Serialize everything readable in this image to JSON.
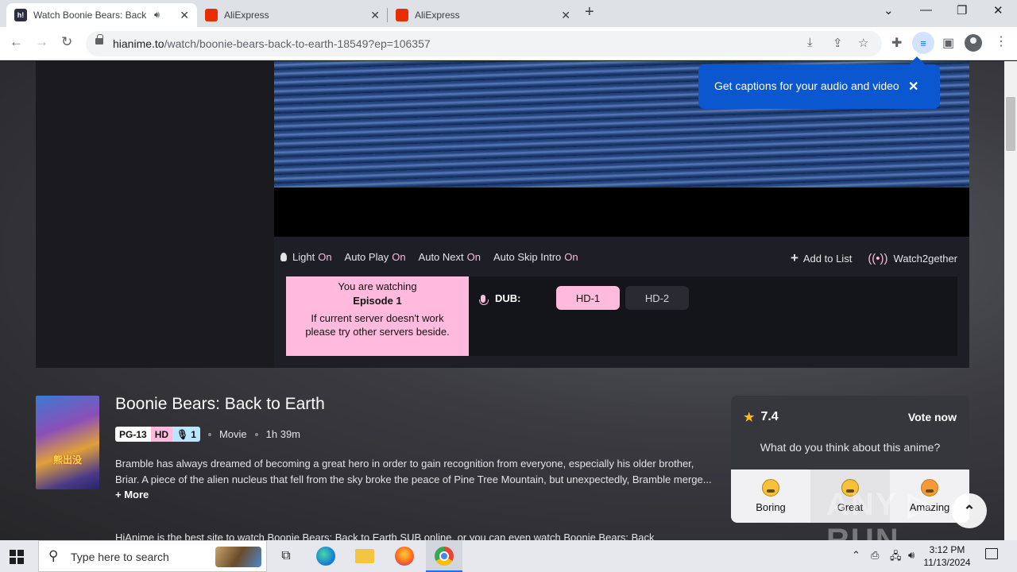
{
  "browser": {
    "tabs": [
      {
        "title": "Watch Boonie Bears: Back to",
        "favicon_label": "h!",
        "favicon_color": "#2b2d42",
        "active": true,
        "audio": true
      },
      {
        "title": "AliExpress",
        "favicon_label": "",
        "favicon_color": "#e62e04",
        "active": false
      },
      {
        "title": "AliExpress",
        "favicon_label": "",
        "favicon_color": "#e62e04",
        "active": false
      }
    ],
    "url_domain": "hianime.to",
    "url_path": "/watch/boonie-bears-back-to-earth-18549?ep=106357",
    "captions_popup": "Get captions for your audio and video"
  },
  "player": {
    "controls": [
      {
        "label": "Light",
        "state": "On"
      },
      {
        "label": "Auto Play",
        "state": "On"
      },
      {
        "label": "Auto Next",
        "state": "On"
      },
      {
        "label": "Auto Skip Intro",
        "state": "On"
      }
    ],
    "add_to_list": "Add to List",
    "watch2gether": "Watch2gether",
    "watching_line1": "You are watching",
    "watching_episode": "Episode 1",
    "watching_hint": "If current server doesn't work please try other servers beside.",
    "dub_label": "DUB:",
    "servers": [
      "HD-1",
      "HD-2"
    ],
    "accent_color": "#ffbade"
  },
  "anime": {
    "title": "Boonie Bears: Back to Earth",
    "badge_rating": "PG-13",
    "badge_quality": "HD",
    "badge_dub": "1",
    "type": "Movie",
    "duration": "1h 39m",
    "description": "Bramble has always dreamed of becoming a great hero in order to gain recognition from everyone, especially his older brother, Briar. A piece of the alien nucleus that fell from the sky broke the peace of Pine Tree Mountain, but unexpectedly, Bramble merge...",
    "more": "+ More",
    "description2": "HiAnime is the best site to watch Boonie Bears: Back to Earth SUB online, or you can even watch Boonie Bears: Back"
  },
  "vote": {
    "score": "7.4",
    "vote_now": "Vote now",
    "question": "What do you think about this anime?",
    "options": [
      "Boring",
      "Great",
      "Amazing"
    ]
  },
  "taskbar": {
    "search_placeholder": "Type here to search",
    "time": "3:12 PM",
    "date": "11/13/2024"
  }
}
